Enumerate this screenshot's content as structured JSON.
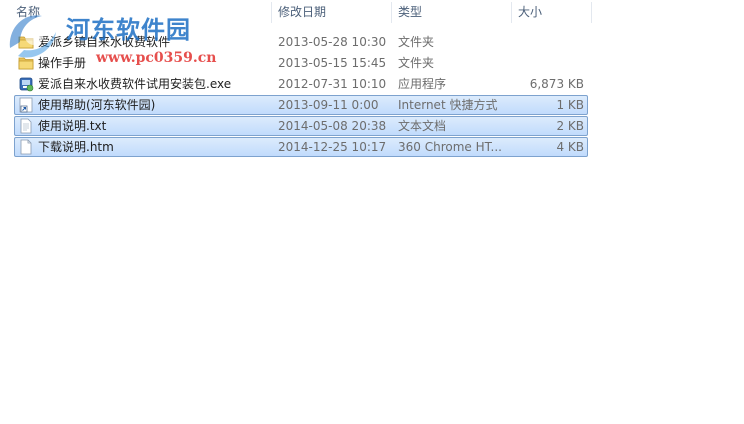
{
  "columns": {
    "name": "名称",
    "date": "修改日期",
    "type": "类型",
    "size": "大小"
  },
  "files": [
    {
      "name": "爱派乡镇自来水收费软件",
      "date": "2013-05-28 10:30",
      "type": "文件夹",
      "size": "",
      "icon": "folder-icon",
      "selected": false
    },
    {
      "name": "操作手册",
      "date": "2013-05-15 15:45",
      "type": "文件夹",
      "size": "",
      "icon": "folder-icon",
      "selected": false
    },
    {
      "name": "爱派自来水收费软件试用安装包.exe",
      "date": "2012-07-31 10:10",
      "type": "应用程序",
      "size": "6,873 KB",
      "icon": "installer-icon",
      "selected": false
    },
    {
      "name": "使用帮助(河东软件园)",
      "date": "2013-09-11 0:00",
      "type": "Internet 快捷方式",
      "size": "1 KB",
      "icon": "internet-shortcut-icon",
      "selected": true
    },
    {
      "name": "使用说明.txt",
      "date": "2014-05-08 20:38",
      "type": "文本文档",
      "size": "2 KB",
      "icon": "text-document-icon",
      "selected": true
    },
    {
      "name": "下载说明.htm",
      "date": "2014-12-25 10:17",
      "type": "360 Chrome HT...",
      "size": "4 KB",
      "icon": "html-document-icon",
      "selected": true
    }
  ],
  "watermark": {
    "title": "河东软件园",
    "url": "www.pc0359.cn"
  },
  "colors": {
    "selection_top": "#dcebfc",
    "selection_bottom": "#c1dbfc",
    "selection_border": "#7da2ce",
    "header_text": "#4c607a",
    "watermark_blue": "#1d6fc4",
    "watermark_red": "#e2312f"
  }
}
